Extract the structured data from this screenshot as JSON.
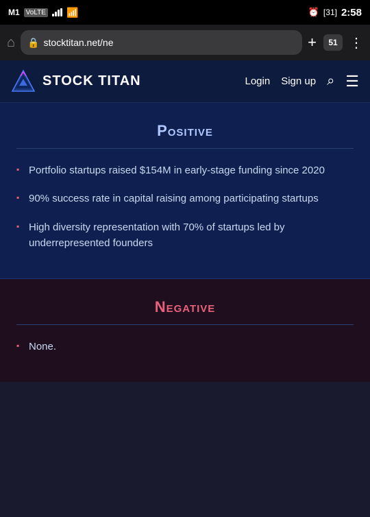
{
  "statusBar": {
    "carrier": "M1",
    "carrierType": "VoLTE",
    "signalBars": 4,
    "wifi": true,
    "alarm": true,
    "battery": "31",
    "time": "2:58"
  },
  "browser": {
    "url": "stocktitan.net/ne",
    "tabCount": "51",
    "addTabLabel": "+",
    "menuLabel": "⋮",
    "homeLabel": "⌂"
  },
  "navbar": {
    "logoText": "STOCK TITAN",
    "loginLabel": "Login",
    "signupLabel": "Sign up"
  },
  "positive": {
    "title": "Positive",
    "bullets": [
      "Portfolio startups raised $154M in early-stage funding since 2020",
      "90% success rate in capital raising among participating startups",
      "High diversity representation with 70% of startups led by underrepresented founders"
    ]
  },
  "negative": {
    "title": "Negative",
    "bullets": [
      "None."
    ]
  }
}
